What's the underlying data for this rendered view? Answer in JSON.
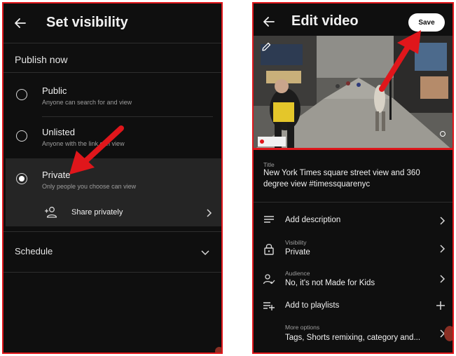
{
  "visibility_screen": {
    "title": "Set visibility",
    "publish_now_label": "Publish now",
    "options": [
      {
        "title": "Public",
        "subtitle": "Anyone can search for and view",
        "selected": false
      },
      {
        "title": "Unlisted",
        "subtitle": "Anyone with the link can view",
        "selected": false
      },
      {
        "title": "Private",
        "subtitle": "Only people you choose can view",
        "selected": true
      }
    ],
    "share_privately_label": "Share privately",
    "schedule_label": "Schedule"
  },
  "edit_screen": {
    "title": "Edit video",
    "save_label": "Save",
    "title_field": {
      "label": "Title",
      "value_line1": "New York Times square street view and 360",
      "value_line2": "degree view #timessquarenyc"
    },
    "add_description_label": "Add description",
    "visibility_field": {
      "label": "Visibility",
      "value": "Private"
    },
    "audience_field": {
      "label": "Audience",
      "value": "No, it's not Made for Kids"
    },
    "add_to_playlists_label": "Add to playlists",
    "more_options_field": {
      "label": "More options",
      "value": "Tags, Shorts remixing, category and..."
    }
  },
  "colors": {
    "annotation_red": "#e0161b",
    "app_background": "#0f0f0f",
    "selected_row_background": "#252525"
  },
  "icons": [
    "back-arrow-icon",
    "radio-icon",
    "share-person-icon",
    "chevron-right-icon",
    "chevron-down-icon",
    "pencil-icon",
    "description-icon",
    "lock-icon",
    "audience-icon",
    "playlist-add-icon",
    "plus-icon"
  ]
}
